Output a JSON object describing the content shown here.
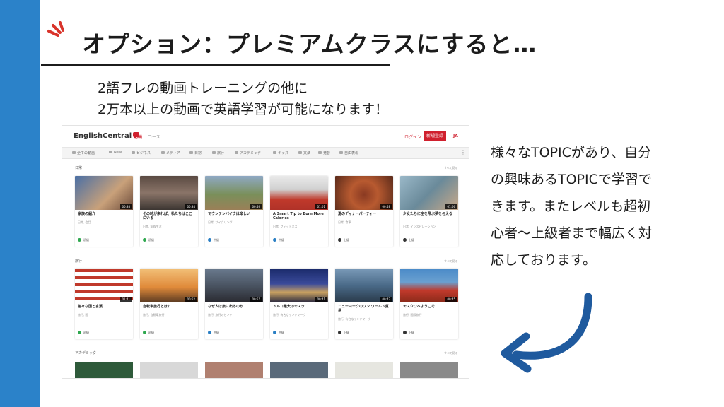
{
  "slide": {
    "title": "オプション：プレミアムクラスにすると…",
    "subtitle_line1": "2語フレの動画トレーニングの他に",
    "subtitle_line2": "2万本以上の動画で英語学習が可能になります！",
    "right_lines": [
      "様々なTOPICがあり、自分",
      "の興味あるTOPICで学習で",
      "きます。またレベルも超初",
      "心者〜上級者まで幅広く対",
      "応しております。"
    ],
    "colors": {
      "side_bar": "#2b82c9",
      "accent": "#d9342b",
      "arrow": "#1f5a9e"
    }
  },
  "site": {
    "logo": "EnglishCentral",
    "nav_active": "動画",
    "nav_other": "コース",
    "login": "ログイン",
    "signup": "新規登録",
    "lang": "JA",
    "categories": [
      "全ての動画",
      "New",
      "ビジネス",
      "メディア",
      "日常",
      "旅行",
      "アカデミック",
      "キッズ",
      "文法",
      "発音",
      "自由表現"
    ],
    "see_all": "すべて見る",
    "sections": [
      {
        "label": "日常",
        "cards": [
          {
            "title": "家族の紹介",
            "sub": "日常, 会話",
            "duration": "00:38",
            "level": "初級"
          },
          {
            "title": "その時が来れば、私たちはここにいる",
            "sub": "日常, 家族生活",
            "duration": "00:34",
            "level": "初級"
          },
          {
            "title": "マウンテンバイクは楽しい",
            "sub": "日常, サイクリング",
            "duration": "00:46",
            "level": "中級"
          },
          {
            "title": "A Smart Tip to Burn More Calories",
            "sub": "日常, フィットネス",
            "duration": "01:01",
            "level": "中級"
          },
          {
            "title": "夏のディナーパーティー",
            "sub": "日常, 食事",
            "duration": "00:58",
            "level": "上級"
          },
          {
            "title": "少女たちに空を飛ぶ夢を与える",
            "sub": "日常, インスピレーション",
            "duration": "01:06",
            "level": "上級"
          }
        ]
      },
      {
        "label": "旅行",
        "cards": [
          {
            "title": "色々な国と言葉",
            "sub": "旅行, 国",
            "duration": "01:41",
            "level": "初級"
          },
          {
            "title": "自転車旅行とは？",
            "sub": "旅行, 自転車旅行",
            "duration": "00:52",
            "level": "初級"
          },
          {
            "title": "なぜ人は旅に出るのか",
            "sub": "旅行, 旅行のヒント",
            "duration": "00:57",
            "level": "中級"
          },
          {
            "title": "トルコ最大のモスク",
            "sub": "旅行, 有名なランドマーク",
            "duration": "00:41",
            "level": "中級"
          },
          {
            "title": "ニューヨークのワン ワールド貿易",
            "sub": "旅行, 有名なランドマーク",
            "duration": "00:42",
            "level": "上級"
          },
          {
            "title": "モスクワへようこそ",
            "sub": "旅行, 国際旅行",
            "duration": "00:45",
            "level": "上級"
          }
        ]
      }
    ],
    "section3_label": "アカデミック",
    "level_colors": {
      "初級": "#2fa84f",
      "中級": "#2a7fc4",
      "上級": "#333333"
    }
  }
}
